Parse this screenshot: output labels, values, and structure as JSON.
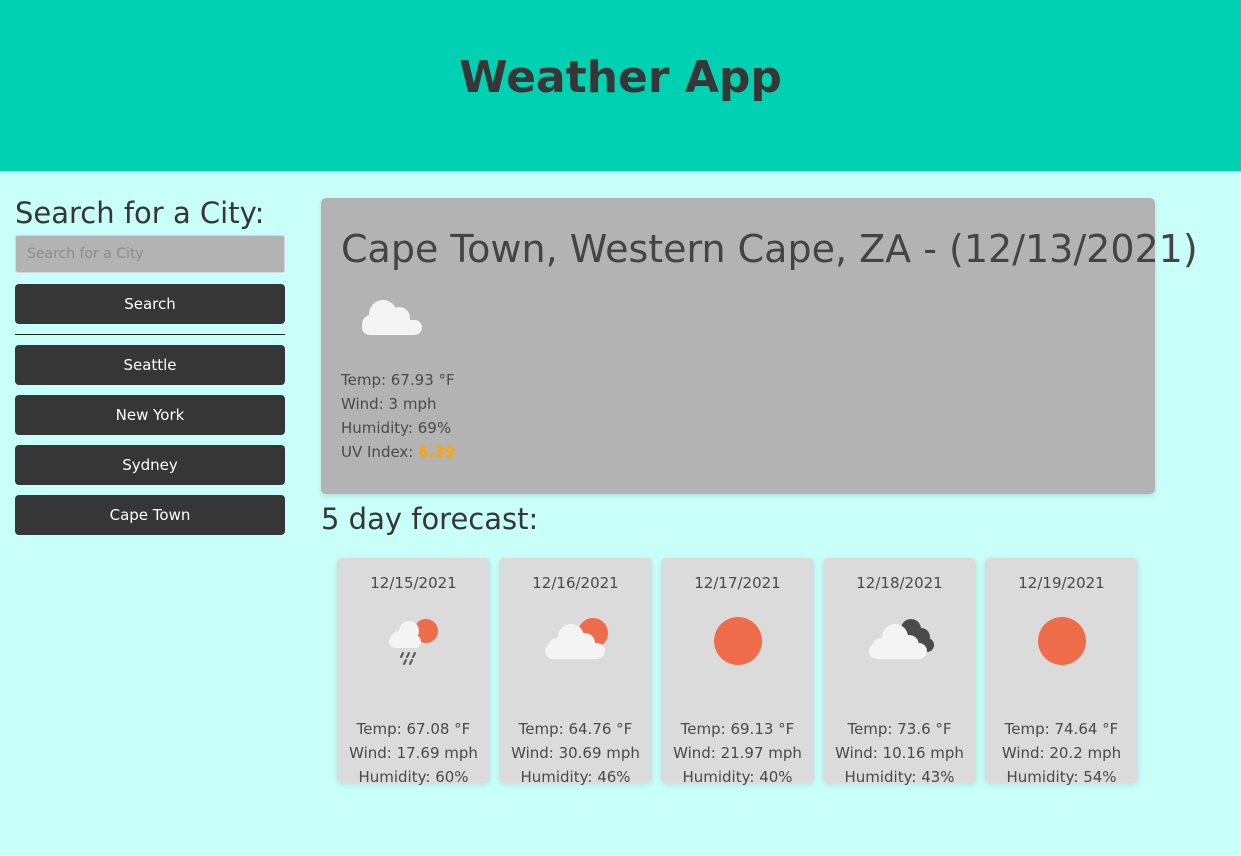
{
  "header": {
    "title": "Weather App"
  },
  "search": {
    "heading": "Search for a City:",
    "placeholder": "Search for a City",
    "button_label": "Search"
  },
  "history": [
    {
      "label": "Seattle"
    },
    {
      "label": "New York"
    },
    {
      "label": "Sydney"
    },
    {
      "label": "Cape Town"
    }
  ],
  "current": {
    "title": "Cape Town, Western Cape, ZA - (12/13/2021)",
    "icon": "cloud-icon",
    "temp": "Temp: 67.93 °F",
    "wind": "Wind: 3 mph",
    "humidity": "Humidity: 69%",
    "uv_label": "UV Index: ",
    "uv_value": "6.39",
    "uv_color": "#ffa500"
  },
  "forecast": {
    "title": "5 day forecast:",
    "days": [
      {
        "date": "12/15/2021",
        "icon": "rain-sun-icon",
        "temp": "Temp: 67.08 °F",
        "wind": "Wind: 17.69 mph",
        "humidity": "Humidity: 60%"
      },
      {
        "date": "12/16/2021",
        "icon": "partly-cloudy-icon",
        "temp": "Temp: 64.76 °F",
        "wind": "Wind: 30.69 mph",
        "humidity": "Humidity: 46%"
      },
      {
        "date": "12/17/2021",
        "icon": "sun-icon",
        "temp": "Temp: 69.13 °F",
        "wind": "Wind: 21.97 mph",
        "humidity": "Humidity: 40%"
      },
      {
        "date": "12/18/2021",
        "icon": "broken-clouds-icon",
        "temp": "Temp: 73.6 °F",
        "wind": "Wind: 10.16 mph",
        "humidity": "Humidity: 43%"
      },
      {
        "date": "12/19/2021",
        "icon": "sun-icon",
        "temp": "Temp: 74.64 °F",
        "wind": "Wind: 20.2 mph",
        "humidity": "Humidity: 54%"
      }
    ]
  },
  "colors": {
    "header_bg": "#00d1b2",
    "page_bg": "#c8fff9",
    "button_bg": "#363636",
    "sun": "#ef6c4b"
  }
}
